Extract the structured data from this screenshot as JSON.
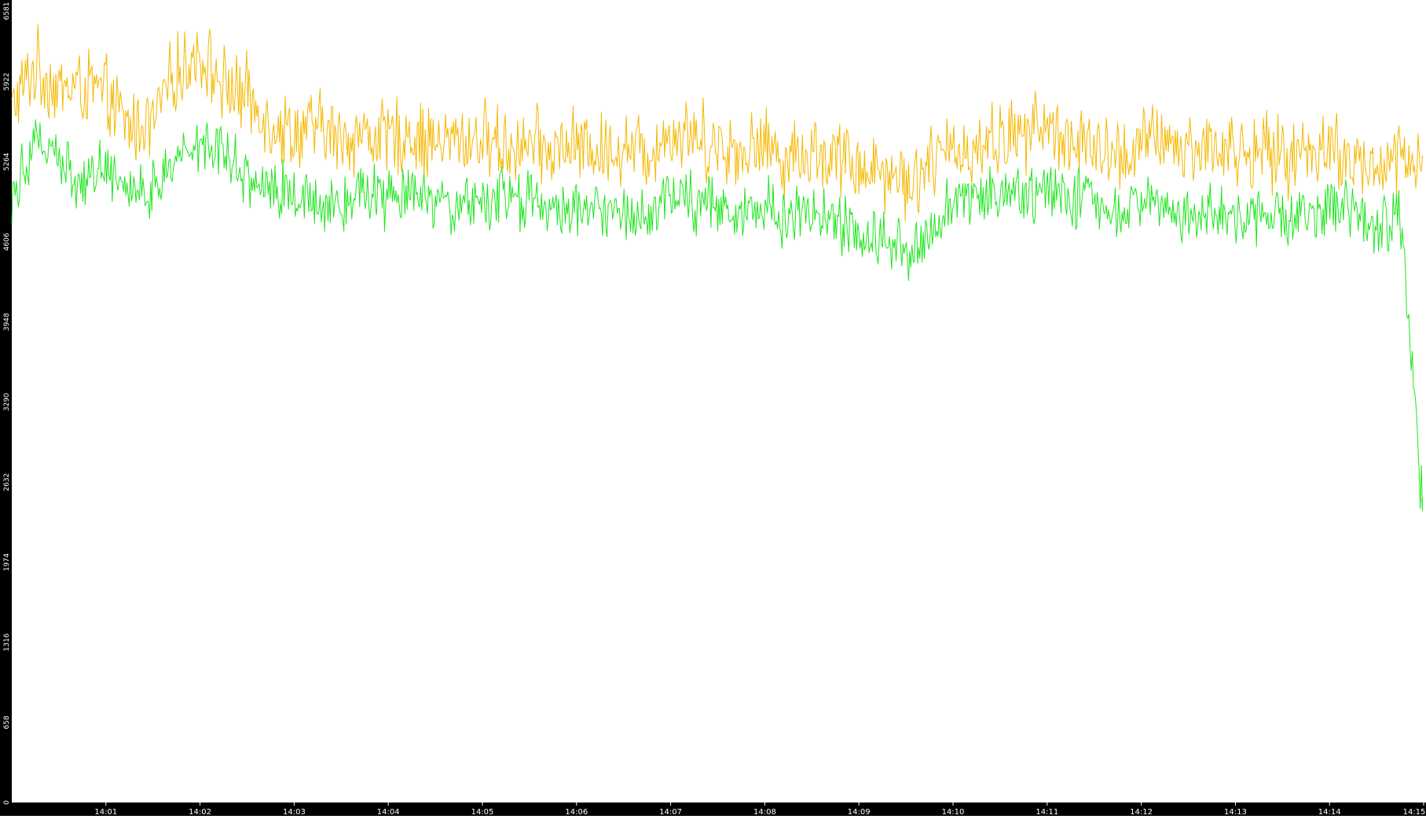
{
  "chart_data": {
    "type": "line",
    "title": "",
    "xlabel": "",
    "ylabel": "",
    "grid": false,
    "legend": "none",
    "xlim_minutes": [
      0,
      15.0
    ],
    "ylim": [
      0,
      6581
    ],
    "y_ticks": [
      "0",
      "658",
      "1316",
      "1974",
      "2632",
      "3290",
      "3948",
      "4606",
      "5264",
      "5922",
      "6581"
    ],
    "x_ticks": [
      {
        "label": "14:01",
        "minute": 1
      },
      {
        "label": "14:02",
        "minute": 2
      },
      {
        "label": "14:03",
        "minute": 3
      },
      {
        "label": "14:04",
        "minute": 4
      },
      {
        "label": "14:05",
        "minute": 5
      },
      {
        "label": "14:06",
        "minute": 6
      },
      {
        "label": "14:07",
        "minute": 7
      },
      {
        "label": "14:08",
        "minute": 8
      },
      {
        "label": "14:09",
        "minute": 9
      },
      {
        "label": "14:10",
        "minute": 10
      },
      {
        "label": "14:11",
        "minute": 11
      },
      {
        "label": "14:12",
        "minute": 12
      },
      {
        "label": "14:13",
        "minute": 13
      },
      {
        "label": "14:14",
        "minute": 14
      },
      {
        "label": "14:15",
        "minute": 15
      }
    ],
    "series": [
      {
        "color": "#f5b800",
        "x_minutes": [
          0.0,
          0.25,
          0.5,
          0.75,
          1.0,
          1.25,
          1.5,
          1.75,
          2.0,
          2.25,
          2.5,
          2.75,
          3.0,
          3.25,
          3.5,
          3.75,
          4.0,
          4.25,
          4.5,
          4.75,
          5.0,
          5.25,
          5.5,
          5.75,
          6.0,
          6.25,
          6.5,
          6.75,
          7.0,
          7.25,
          7.5,
          7.75,
          8.0,
          8.25,
          8.5,
          8.75,
          9.0,
          9.25,
          9.5,
          9.75,
          10.0,
          10.25,
          10.5,
          10.75,
          11.0,
          11.25,
          11.5,
          11.75,
          12.0,
          12.25,
          12.5,
          12.75,
          13.0,
          13.25,
          13.5,
          13.75,
          14.0,
          14.25,
          14.5,
          14.75,
          14.98
        ],
        "values": [
          5700,
          6050,
          5850,
          5900,
          5800,
          5550,
          5600,
          6000,
          6150,
          5900,
          5800,
          5600,
          5500,
          5550,
          5450,
          5500,
          5450,
          5500,
          5400,
          5450,
          5450,
          5400,
          5400,
          5350,
          5400,
          5350,
          5400,
          5350,
          5500,
          5500,
          5400,
          5350,
          5400,
          5300,
          5350,
          5300,
          5250,
          5200,
          5100,
          5250,
          5350,
          5400,
          5450,
          5500,
          5550,
          5450,
          5350,
          5300,
          5400,
          5450,
          5350,
          5400,
          5350,
          5350,
          5300,
          5350,
          5400,
          5250,
          5200,
          5300,
          5300
        ]
      },
      {
        "color": "#1ee61e",
        "x_minutes": [
          0.0,
          0.25,
          0.5,
          0.75,
          1.0,
          1.25,
          1.5,
          1.75,
          2.0,
          2.25,
          2.5,
          2.75,
          3.0,
          3.25,
          3.5,
          3.75,
          4.0,
          4.25,
          4.5,
          4.75,
          5.0,
          5.25,
          5.5,
          5.75,
          6.0,
          6.25,
          6.5,
          6.75,
          7.0,
          7.25,
          7.5,
          7.75,
          8.0,
          8.25,
          8.5,
          8.75,
          9.0,
          9.25,
          9.5,
          9.75,
          10.0,
          10.25,
          10.5,
          10.75,
          11.0,
          11.25,
          11.5,
          11.75,
          12.0,
          12.25,
          12.5,
          12.75,
          13.0,
          13.25,
          13.5,
          13.75,
          14.0,
          14.25,
          14.5,
          14.75,
          14.98
        ],
        "values": [
          5000,
          5500,
          5250,
          5100,
          5250,
          5050,
          5000,
          5300,
          5450,
          5400,
          5150,
          5050,
          5000,
          4950,
          4950,
          5050,
          4950,
          5000,
          4850,
          4900,
          4950,
          4950,
          4950,
          4850,
          4900,
          4850,
          4850,
          4850,
          5000,
          4950,
          4900,
          4850,
          4900,
          4800,
          4850,
          4750,
          4700,
          4650,
          4500,
          4750,
          4900,
          5000,
          5050,
          4950,
          5050,
          5000,
          4900,
          4850,
          4900,
          4900,
          4850,
          4850,
          4800,
          4850,
          4800,
          4850,
          4850,
          4850,
          4700,
          4850,
          2500
        ]
      }
    ]
  }
}
